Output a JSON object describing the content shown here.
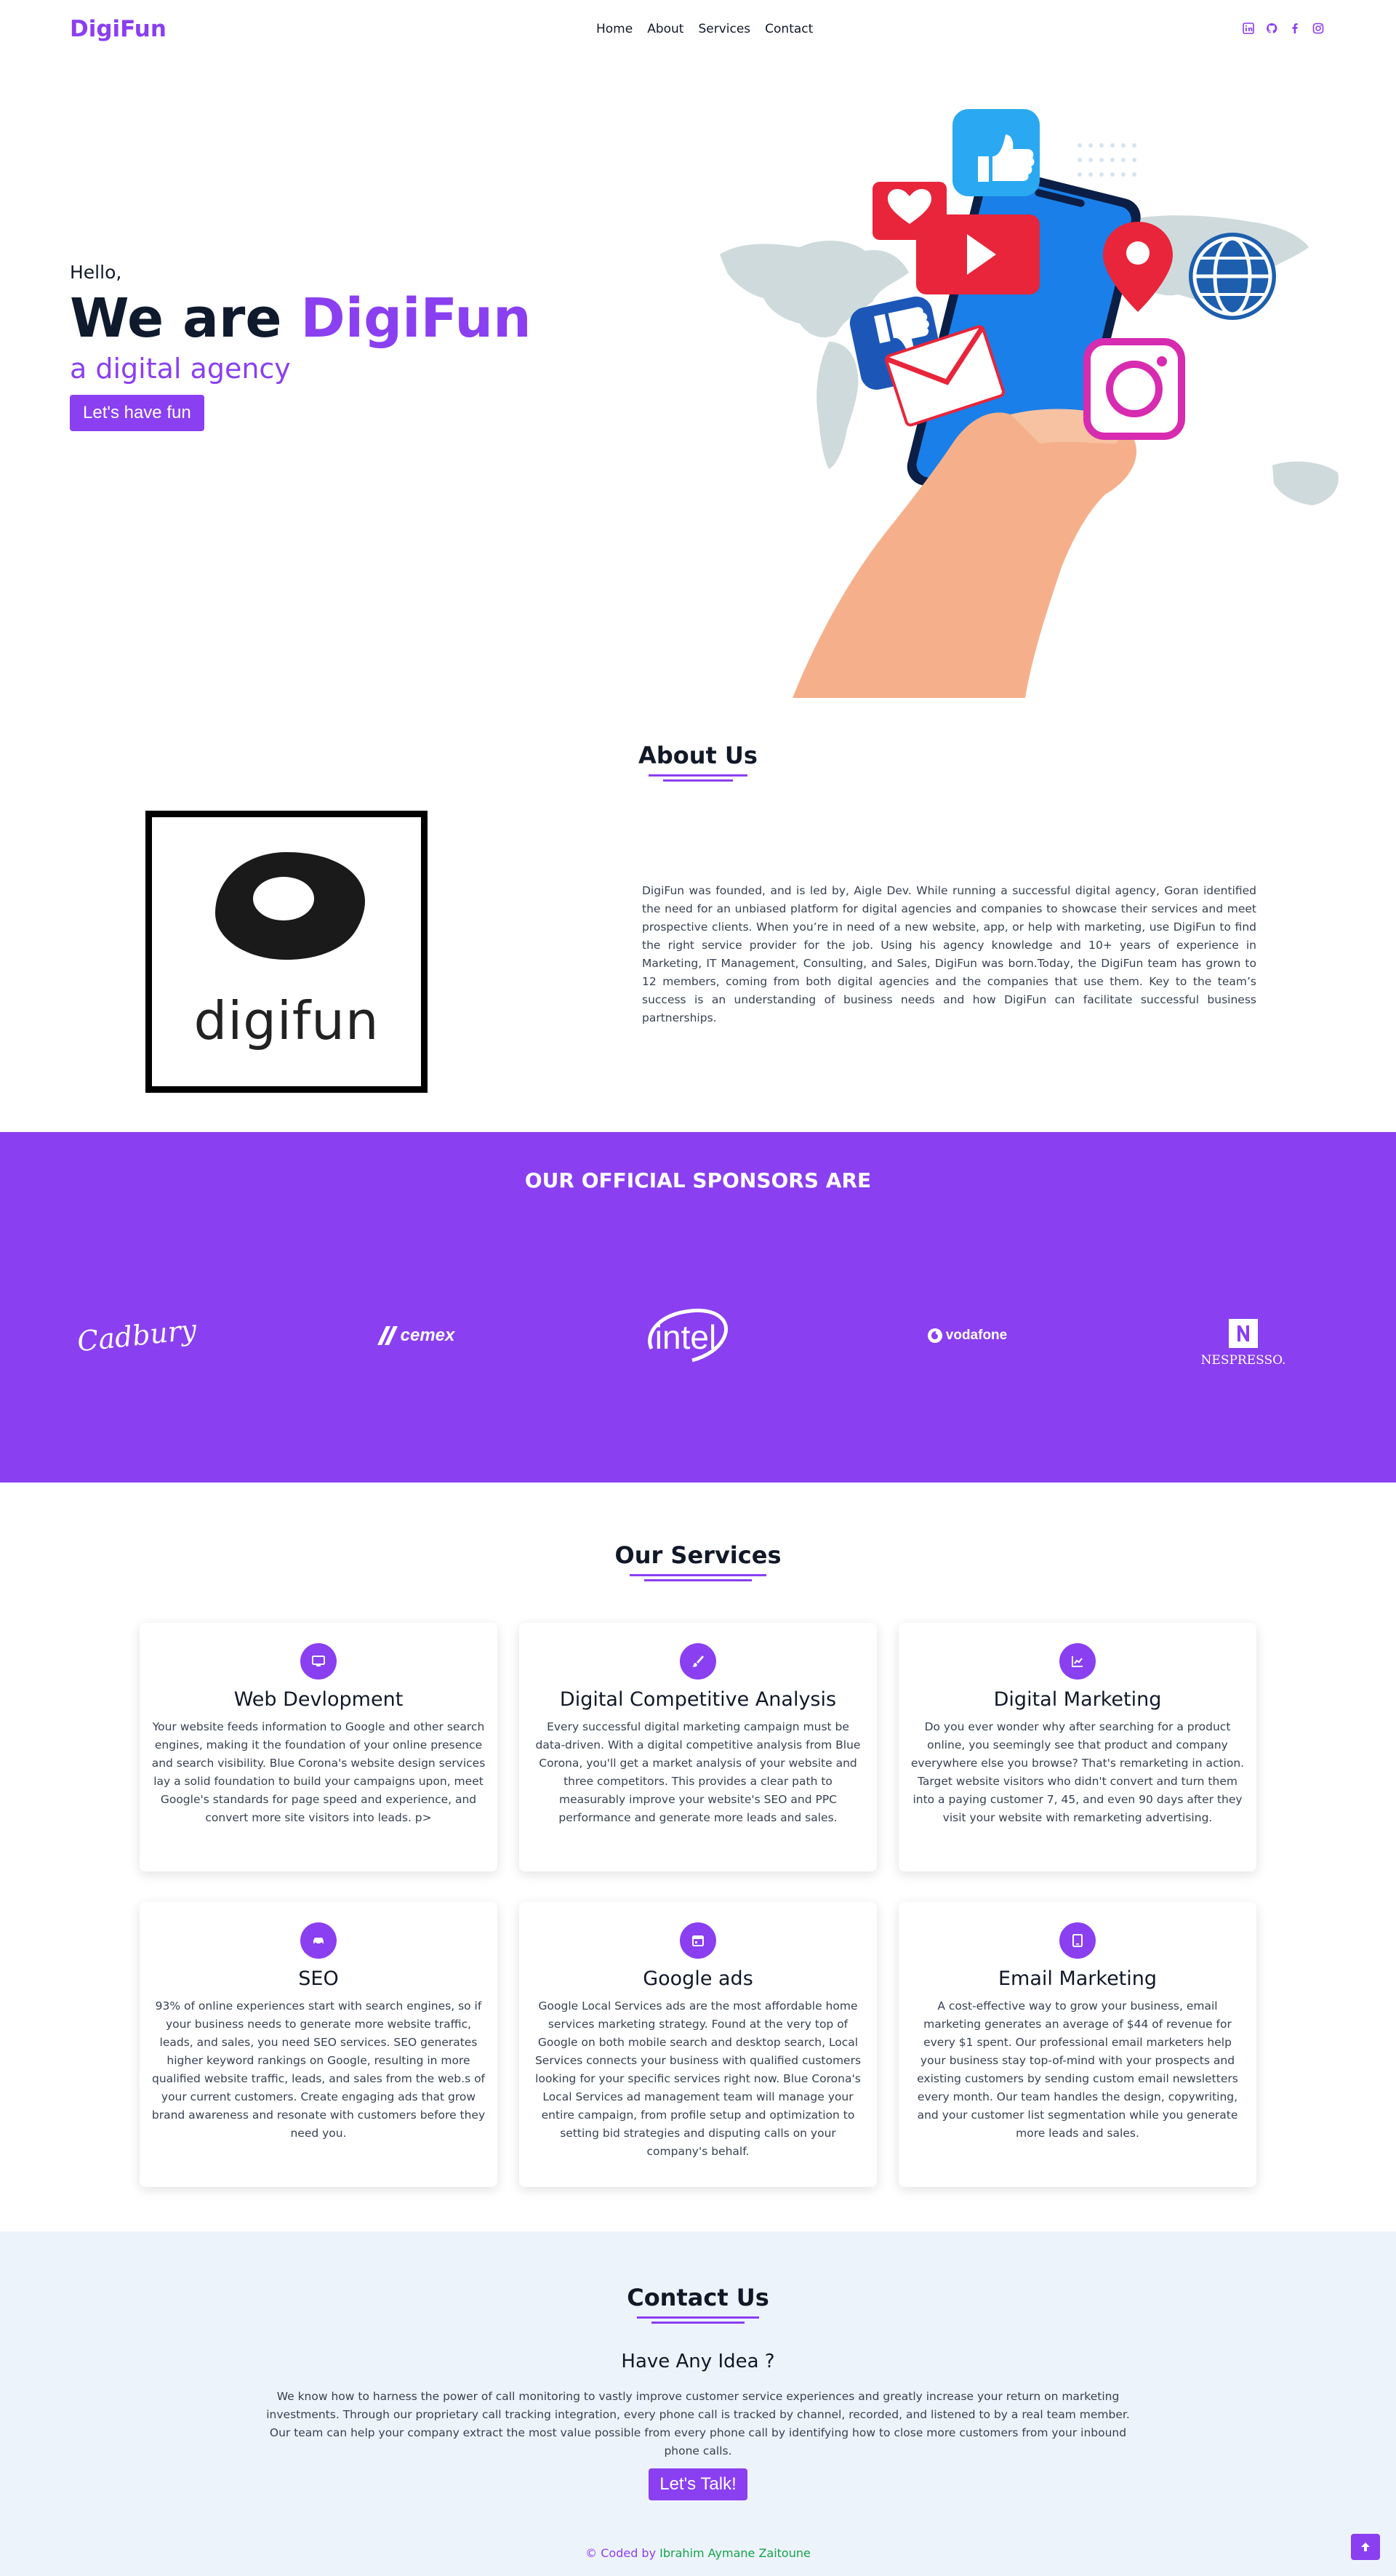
{
  "nav": {
    "brand": "DigiFun",
    "links": [
      "Home",
      "About",
      "Services",
      "Contact"
    ],
    "socials": [
      "linkedin-icon",
      "github-icon",
      "facebook-icon",
      "instagram-icon"
    ]
  },
  "hero": {
    "hello": "Hello,",
    "title_prefix": "We are ",
    "title_highlight": "DigiFun",
    "subtitle": "a digital agency",
    "button": "Let's have fun"
  },
  "about": {
    "title": "About Us",
    "logo_text": "digifun",
    "text": "DigiFun was founded, and is led by, Aigle Dev. While running a successful digital agency, Goran identified the need for an unbiased platform for digital agencies and companies to showcase their services and meet prospective clients. When you’re in need of a new website, app, or help with marketing, use DigiFun to find the right service provider for the job. Using his agency knowledge and 10+ years of experience in Marketing, IT Management, Consulting, and Sales, DigiFun was born.Today, the DigiFun team has grown to 12 members, coming from both digital agencies and the companies that use them. Key to the team’s success is an understanding of business needs and how DigiFun can facilitate successful business partnerships."
  },
  "sponsors": {
    "title": "OUR OFFICIAL SPONSORS ARE",
    "logos": [
      "Cadbury",
      "cemex",
      "intel",
      "vodafone",
      "NESPRESSO."
    ]
  },
  "services": {
    "title": "Our Services",
    "items": [
      {
        "icon": "monitor-icon",
        "title": "Web Devlopment",
        "text": "Your website feeds information to Google and other search engines, making it the foundation of your online presence and search visibility. Blue Corona's website design services lay a solid foundation to build your campaigns upon, meet Google's standards for page speed and experience, and convert more site visitors into leads. p>"
      },
      {
        "icon": "brush-icon",
        "title": "Digital Competitive Analysis",
        "text": "Every successful digital marketing campaign must be data-driven. With a digital competitive analysis from Blue Corona, you'll get a market analysis of your website and three competitors. This provides a clear path to measurably improve your website's SEO and PPC performance and generate more leads and sales."
      },
      {
        "icon": "chart-icon",
        "title": "Digital Marketing",
        "text": "Do you ever wonder why after searching for a product online, you seemingly see that product and company everywhere else you browse? That's remarketing in action. Target website visitors who didn't convert and turn them into a paying customer 7, 45, and even 90 days after they visit your website with remarketing advertising."
      },
      {
        "icon": "car-icon",
        "title": "SEO",
        "text": "93% of online experiences start with search engines, so if your business needs to generate more website traffic, leads, and sales, you need SEO services. SEO generates higher keyword rankings on Google, resulting in more qualified website traffic, leads, and sales from the web.s of your current customers. Create engaging ads that grow brand awareness and resonate with customers before they need you."
      },
      {
        "icon": "calendar-icon",
        "title": "Google ads",
        "text": "Google Local Services ads are the most affordable home services marketing strategy. Found at the very top of Google on both mobile search and desktop search, Local Services connects your business with qualified customers looking for your specific services right now. Blue Corona's Local Services ad management team will manage your entire campaign, from profile setup and optimization to setting bid strategies and disputing calls on your company's behalf."
      },
      {
        "icon": "tablet-icon",
        "title": "Email Marketing",
        "text": "A cost-effective way to grow your business, email marketing generates an average of $44 of revenue for every $1 spent. Our professional email marketers help your business stay top-of-mind with your prospects and existing customers by sending custom email newsletters every month. Our team handles the design, copywriting, and your customer list segmentation while you generate more leads and sales."
      }
    ]
  },
  "contact": {
    "title": "Contact Us",
    "subtitle": "Have Any Idea ?",
    "text": "We know how to harness the power of call monitoring to vastly improve customer service experiences and greatly increase your return on marketing investments. Through our proprietary call tracking integration, every phone call is tracked by channel, recorded, and listened to by a real team member. Our team can help your company extract the most value possible from every phone call by identifying how to close more customers from your inbound phone calls.",
    "button": "Let's Talk!"
  },
  "footer": {
    "prefix": "© Coded by ",
    "author": "Ibrahim Aymane Zaitoune"
  },
  "colors": {
    "accent": "#8a3ff0",
    "dark": "#0f1b2d",
    "contact_bg": "#edf3fb"
  }
}
